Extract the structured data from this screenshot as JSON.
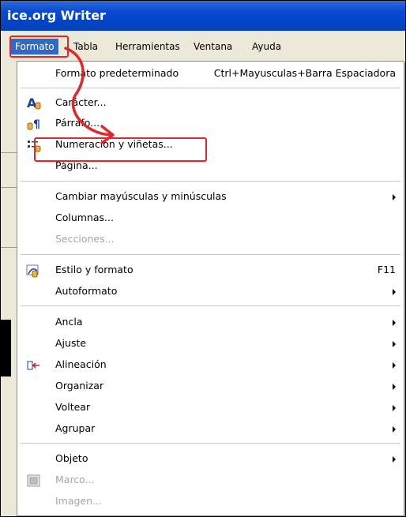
{
  "window": {
    "title": "ice.org Writer"
  },
  "menubar": {
    "items": [
      {
        "id": "formato",
        "label": "Formato"
      },
      {
        "id": "tabla",
        "label": "Tabla"
      },
      {
        "id": "herramientas",
        "label": "Herramientas"
      },
      {
        "id": "ventana",
        "label": "Ventana"
      },
      {
        "id": "ayuda",
        "label": "Ayuda"
      }
    ]
  },
  "menu": {
    "formato_predeterminado": {
      "label": "Formato predeterminado",
      "shortcut": "Ctrl+Mayusculas+Barra Espaciadora"
    },
    "caracter": {
      "label": "Carácter...",
      "icon": "character-icon"
    },
    "parrafo": {
      "label": "Párrafo...",
      "icon": "paragraph-icon"
    },
    "numeracion": {
      "label": "Numeración y viñetas...",
      "icon": "bullets-numbering-icon"
    },
    "pagina": {
      "label": "Página..."
    },
    "cambiar": {
      "label": "Cambiar mayúsculas y minúsculas"
    },
    "columnas": {
      "label": "Columnas..."
    },
    "secciones": {
      "label": "Secciones...",
      "disabled": true
    },
    "estilo": {
      "label": "Estilo y formato",
      "shortcut": "F11",
      "icon": "styles-formatting-icon"
    },
    "autoformato": {
      "label": "Autoformato"
    },
    "ancla": {
      "label": "Ancla"
    },
    "ajuste": {
      "label": "Ajuste"
    },
    "alineacion": {
      "label": "Alineación",
      "icon": "alignment-icon"
    },
    "organizar": {
      "label": "Organizar"
    },
    "voltear": {
      "label": "Voltear"
    },
    "agrupar": {
      "label": "Agrupar"
    },
    "objeto": {
      "label": "Objeto"
    },
    "marco": {
      "label": "Marco...",
      "disabled": true,
      "icon": "frame-icon"
    },
    "imagen": {
      "label": "Imagen...",
      "disabled": true
    }
  },
  "colors": {
    "title_bar": "#0a4ad0",
    "highlight": "#316ac5",
    "annotation": "#e3262c"
  }
}
